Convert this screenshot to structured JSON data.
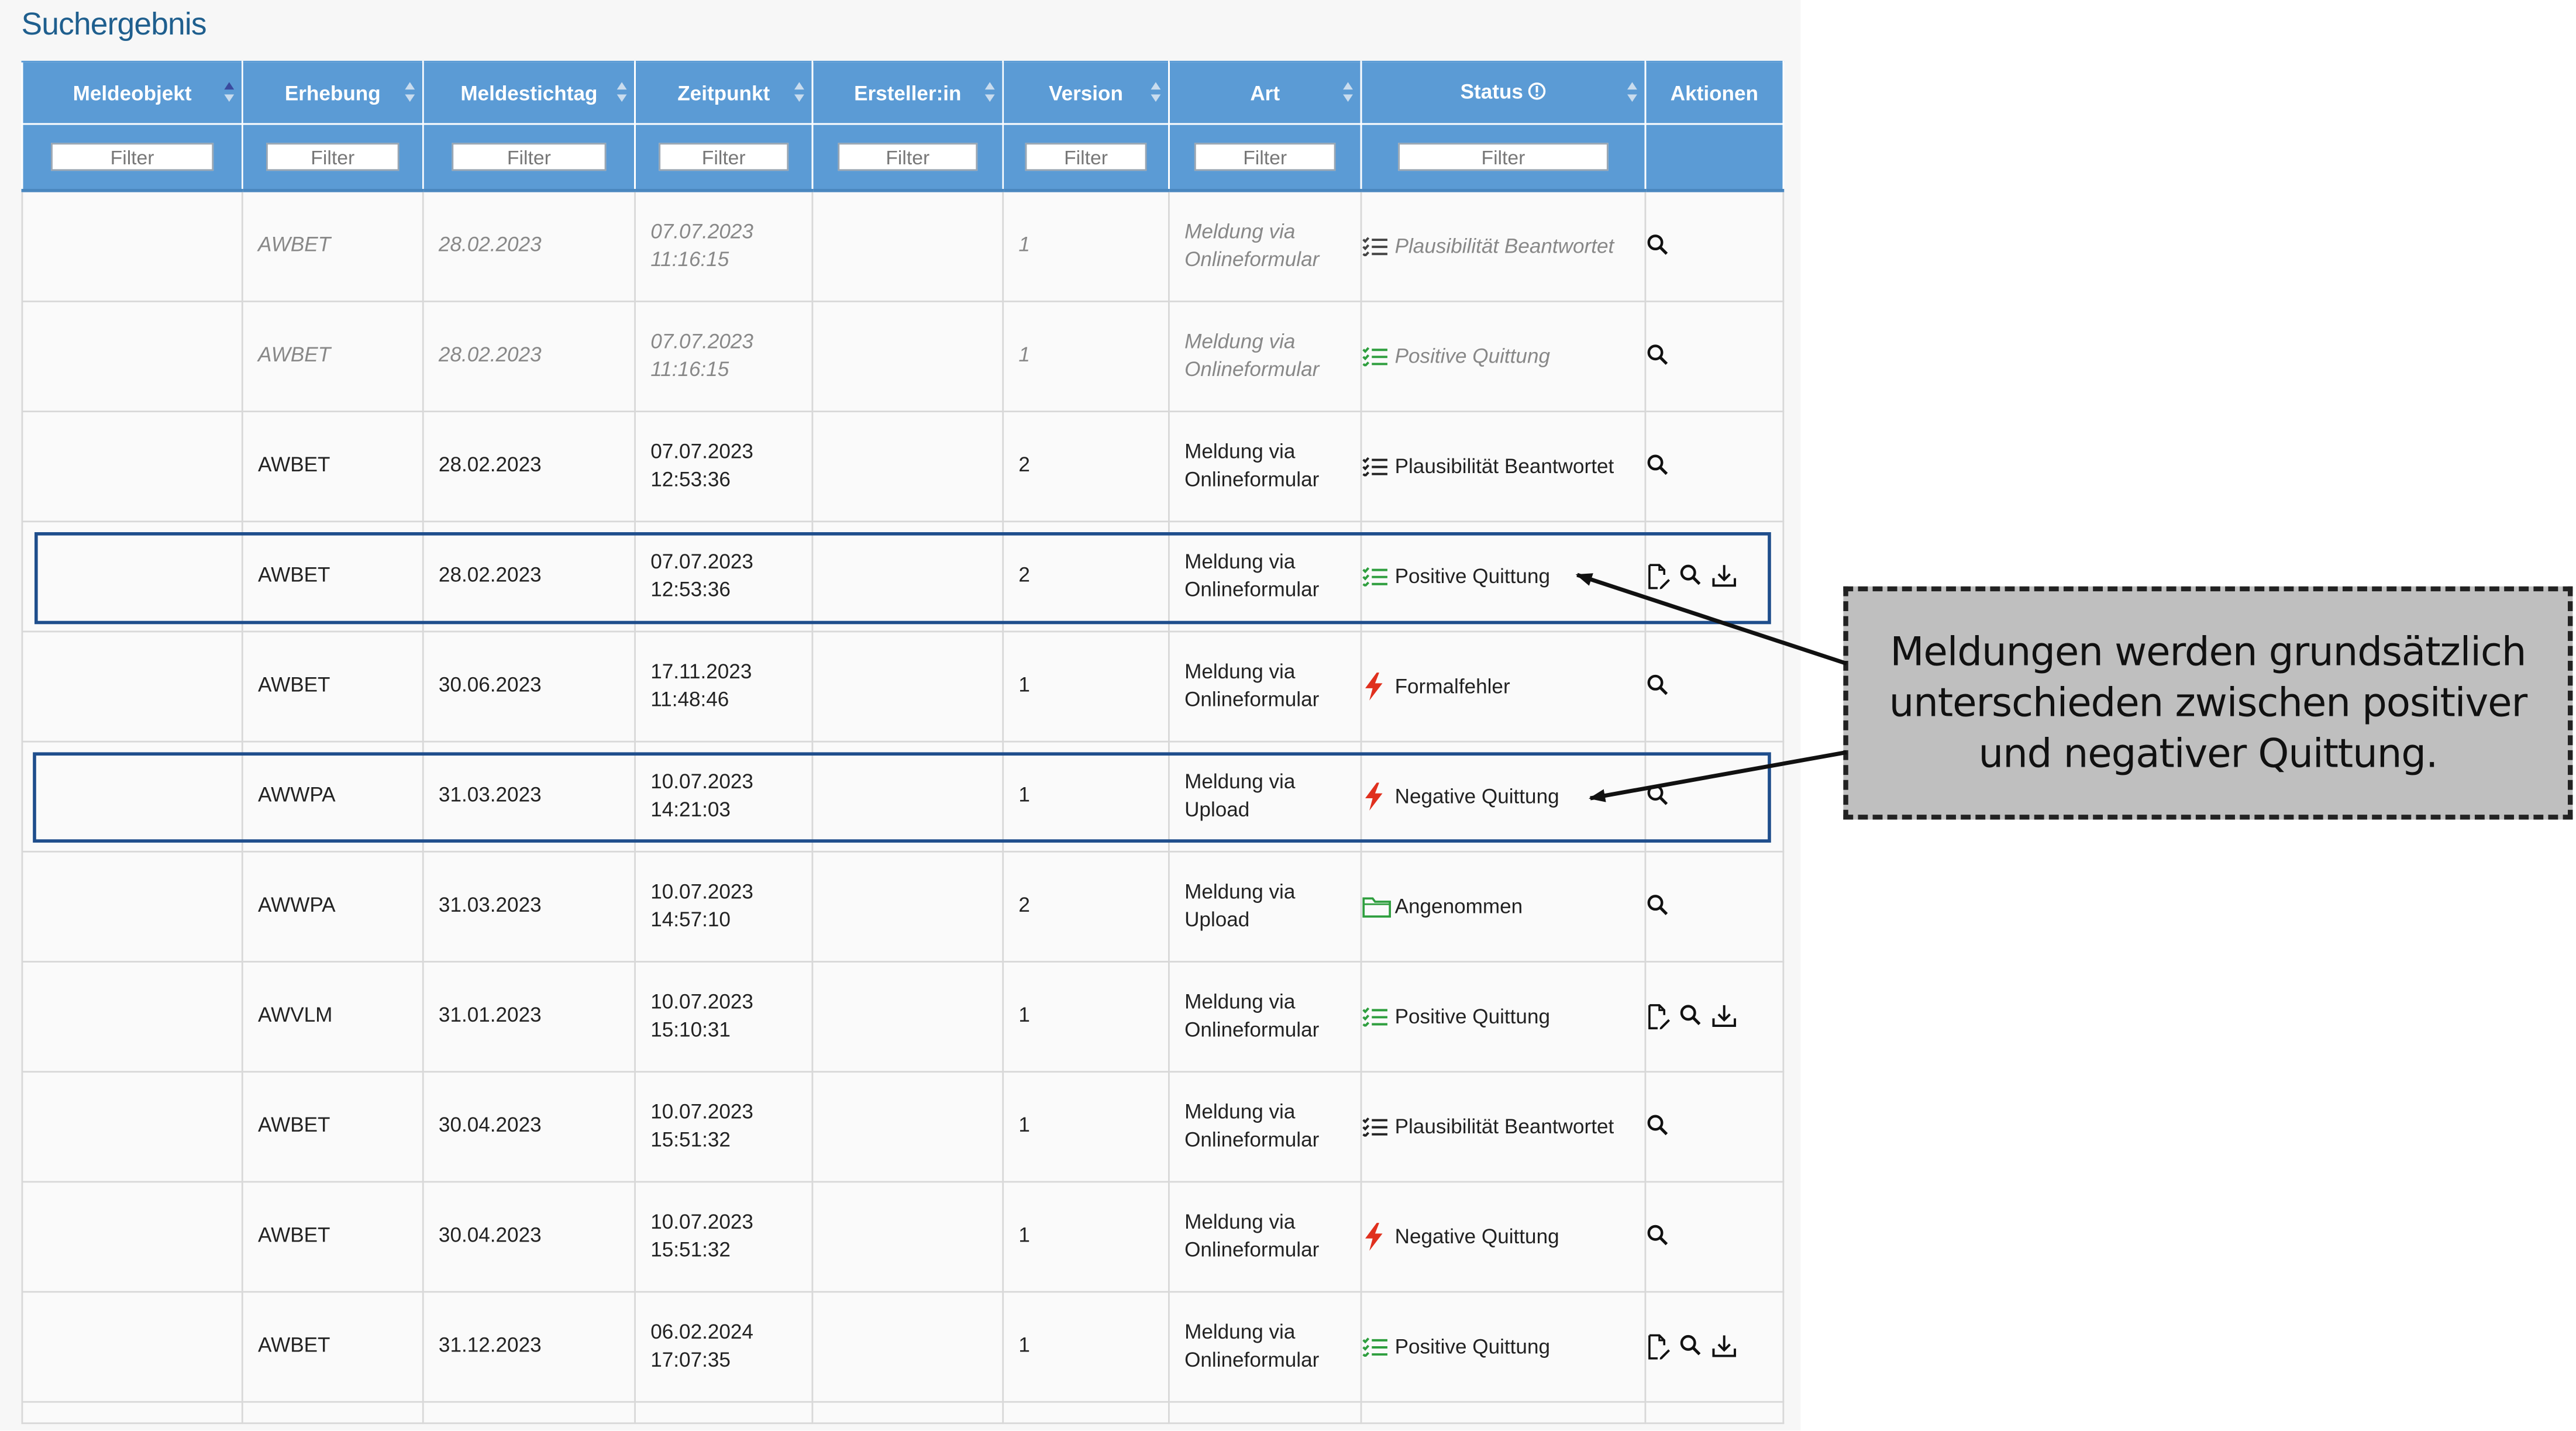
{
  "title": "Suchergebnis",
  "columns": [
    {
      "label": "Meldeobjekt",
      "sorted": "asc"
    },
    {
      "label": "Erhebung"
    },
    {
      "label": "Meldestichtag"
    },
    {
      "label": "Zeitpunkt"
    },
    {
      "label": "Ersteller:in"
    },
    {
      "label": "Version"
    },
    {
      "label": "Art"
    },
    {
      "label": "Status",
      "info_icon": "info-circle-icon"
    },
    {
      "label": "Aktionen"
    }
  ],
  "filter_placeholder": "Filter",
  "rows": [
    {
      "meldeobjekt": "",
      "erhebung": "AWBET",
      "meldestichtag": "28.02.2023",
      "datum": "07.07.2023",
      "zeit": "11:16:15",
      "ersteller": "",
      "version": "1",
      "art1": "Meldung via",
      "art2": "Onlineformular",
      "status": "Plausibilität Beantwortet",
      "status_icon": "checklist-icon",
      "muted": true,
      "actions": [
        "search-icon"
      ]
    },
    {
      "meldeobjekt": "",
      "erhebung": "AWBET",
      "meldestichtag": "28.02.2023",
      "datum": "07.07.2023",
      "zeit": "11:16:15",
      "ersteller": "",
      "version": "1",
      "art1": "Meldung via",
      "art2": "Onlineformular",
      "status": "Positive Quittung",
      "status_icon": "green-checklist-icon",
      "muted": true,
      "actions": [
        "search-icon"
      ]
    },
    {
      "meldeobjekt": "",
      "erhebung": "AWBET",
      "meldestichtag": "28.02.2023",
      "datum": "07.07.2023",
      "zeit": "12:53:36",
      "ersteller": "",
      "version": "2",
      "art1": "Meldung via",
      "art2": "Onlineformular",
      "status": "Plausibilität Beantwortet",
      "status_icon": "checklist-icon",
      "muted": false,
      "actions": [
        "search-icon"
      ]
    },
    {
      "meldeobjekt": "",
      "erhebung": "AWBET",
      "meldestichtag": "28.02.2023",
      "datum": "07.07.2023",
      "zeit": "12:53:36",
      "ersteller": "",
      "version": "2",
      "art1": "Meldung via",
      "art2": "Onlineformular",
      "status": "Positive Quittung",
      "status_icon": "green-checklist-icon",
      "muted": false,
      "actions": [
        "document-edit-icon",
        "search-icon",
        "download-icon"
      ]
    },
    {
      "meldeobjekt": "",
      "erhebung": "AWBET",
      "meldestichtag": "30.06.2023",
      "datum": "17.11.2023",
      "zeit": "11:48:46",
      "ersteller": "",
      "version": "1",
      "art1": "Meldung via",
      "art2": "Onlineformular",
      "status": "Formalfehler",
      "status_icon": "lightning-icon",
      "muted": false,
      "actions": [
        "search-icon"
      ]
    },
    {
      "meldeobjekt": "",
      "erhebung": "AWWPA",
      "meldestichtag": "31.03.2023",
      "datum": "10.07.2023",
      "zeit": "14:21:03",
      "ersteller": "",
      "version": "1",
      "art1": "Meldung via",
      "art2": "Upload",
      "status": "Negative Quittung",
      "status_icon": "lightning-icon",
      "muted": false,
      "actions": [
        "search-icon"
      ]
    },
    {
      "meldeobjekt": "",
      "erhebung": "AWWPA",
      "meldestichtag": "31.03.2023",
      "datum": "10.07.2023",
      "zeit": "14:57:10",
      "ersteller": "",
      "version": "2",
      "art1": "Meldung via",
      "art2": "Upload",
      "status": "Angenommen",
      "status_icon": "folder-icon",
      "muted": false,
      "actions": [
        "search-icon"
      ]
    },
    {
      "meldeobjekt": "",
      "erhebung": "AWVLM",
      "meldestichtag": "31.01.2023",
      "datum": "10.07.2023",
      "zeit": "15:10:31",
      "ersteller": "",
      "version": "1",
      "art1": "Meldung via",
      "art2": "Onlineformular",
      "status": "Positive Quittung",
      "status_icon": "green-checklist-icon",
      "muted": false,
      "actions": [
        "document-edit-icon",
        "search-icon",
        "download-icon"
      ]
    },
    {
      "meldeobjekt": "",
      "erhebung": "AWBET",
      "meldestichtag": "30.04.2023",
      "datum": "10.07.2023",
      "zeit": "15:51:32",
      "ersteller": "",
      "version": "1",
      "art1": "Meldung via",
      "art2": "Onlineformular",
      "status": "Plausibilität Beantwortet",
      "status_icon": "checklist-icon",
      "muted": false,
      "actions": [
        "search-icon"
      ]
    },
    {
      "meldeobjekt": "",
      "erhebung": "AWBET",
      "meldestichtag": "30.04.2023",
      "datum": "10.07.2023",
      "zeit": "15:51:32",
      "ersteller": "",
      "version": "1",
      "art1": "Meldung via",
      "art2": "Onlineformular",
      "status": "Negative Quittung",
      "status_icon": "lightning-icon",
      "muted": false,
      "actions": [
        "search-icon"
      ]
    },
    {
      "meldeobjekt": "",
      "erhebung": "AWBET",
      "meldestichtag": "31.12.2023",
      "datum": "06.02.2024",
      "zeit": "17:07:35",
      "ersteller": "",
      "version": "1",
      "art1": "Meldung via",
      "art2": "Onlineformular",
      "status": "Positive Quittung",
      "status_icon": "green-checklist-icon",
      "muted": false,
      "actions": [
        "document-edit-icon",
        "search-icon",
        "download-icon"
      ]
    }
  ],
  "highlighted_rows": [
    3,
    5
  ],
  "callout": {
    "text": "Meldungen werden grundsätzlich unterschieden zwischen positiver und negativer Quittung."
  },
  "colors": {
    "header_bg": "#5b9bd5",
    "title": "#1f5f8e",
    "positive": "#2e9e3e",
    "negative": "#e0301e",
    "highlight_border": "#1f4e8c",
    "callout_bg": "#bfbfbf"
  }
}
